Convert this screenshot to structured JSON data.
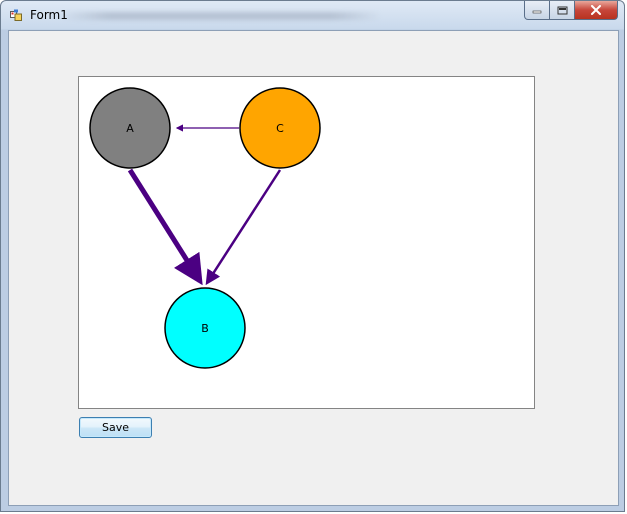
{
  "window": {
    "title": "Form1",
    "icon": "winforms-app-icon",
    "controls": [
      "minimize-icon",
      "maximize-icon",
      "close-icon"
    ]
  },
  "graph": {
    "nodes": [
      {
        "id": "A",
        "label": "A",
        "color": "#808080"
      },
      {
        "id": "B",
        "label": "B",
        "color": "#00FFFF"
      },
      {
        "id": "C",
        "label": "C",
        "color": "#FFA500"
      }
    ],
    "edges": [
      {
        "from": "A",
        "to": "B",
        "weight": "heavy",
        "color": "#4B0082"
      },
      {
        "from": "C",
        "to": "B",
        "weight": "medium",
        "color": "#4B0082"
      },
      {
        "from": "C",
        "to": "A",
        "weight": "light",
        "color": "#4B0082"
      }
    ]
  },
  "actions": {
    "save_label": "Save"
  }
}
